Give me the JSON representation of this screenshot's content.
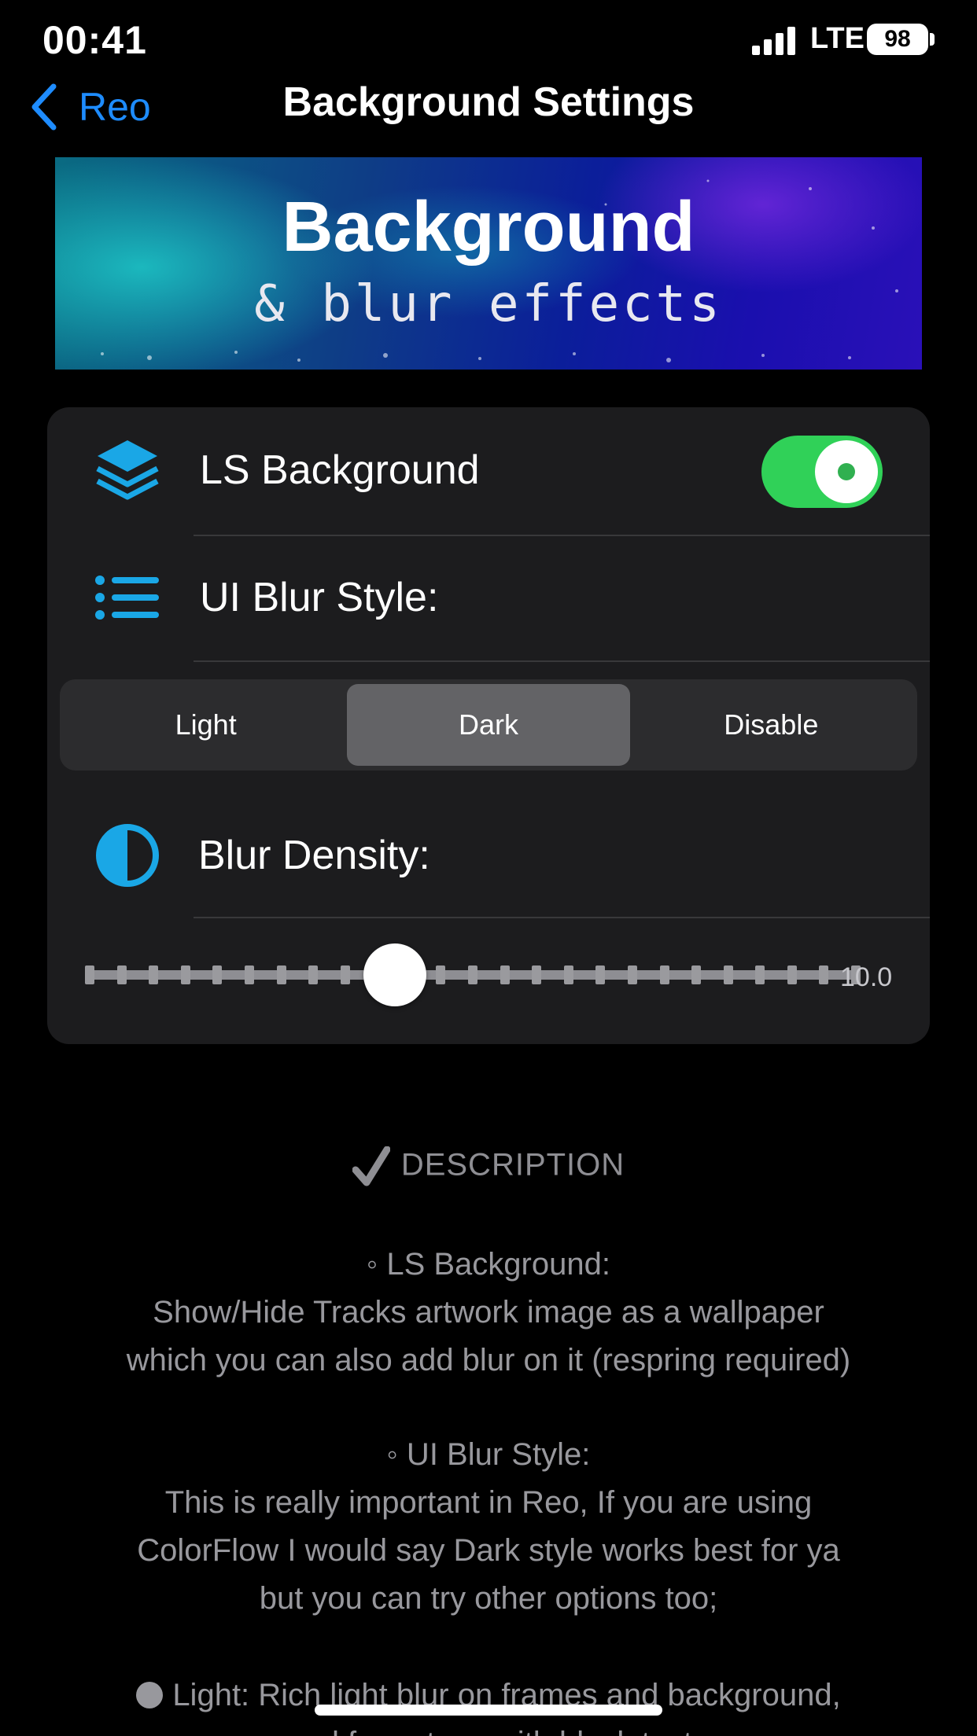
{
  "status_bar": {
    "time": "00:41",
    "network": "LTE",
    "battery": "98"
  },
  "nav": {
    "back_label": "Reo",
    "title": "Background Settings"
  },
  "banner": {
    "title": "Background",
    "subtitle": "& blur effects"
  },
  "settings": {
    "ls_background": {
      "label": "LS Background",
      "icon": "layers-icon",
      "enabled": true
    },
    "ui_blur_style": {
      "label": "UI Blur Style:",
      "icon": "list-icon",
      "options": [
        "Light",
        "Dark",
        "Disable"
      ],
      "selected": "Dark"
    },
    "blur_density": {
      "label": "Blur Density:",
      "icon": "half-circle-icon",
      "value": 10.0,
      "value_label": "10.0",
      "min": 0,
      "max": 25
    }
  },
  "description": {
    "header": "DESCRIPTION",
    "ls_background_title": "◦ LS Background:",
    "ls_background_line1": "Show/Hide Tracks artwork image as a wallpaper",
    "ls_background_line2": "which you can also add blur on it (respring required)",
    "ui_blur_title": "◦ UI Blur Style:",
    "ui_blur_line1": "This is really important in Reo, If you are using",
    "ui_blur_line2": "ColorFlow I would say Dark style works best for ya",
    "ui_blur_line3": "but you can try other options too;",
    "light_option": "Light: Rich light blur on frames and background,",
    "light_option_line2": "good for setups with black texts"
  },
  "colors": {
    "accent_blue": "#1e8cff",
    "icon_cyan": "#1aa7e6",
    "toggle_green": "#30d158"
  }
}
